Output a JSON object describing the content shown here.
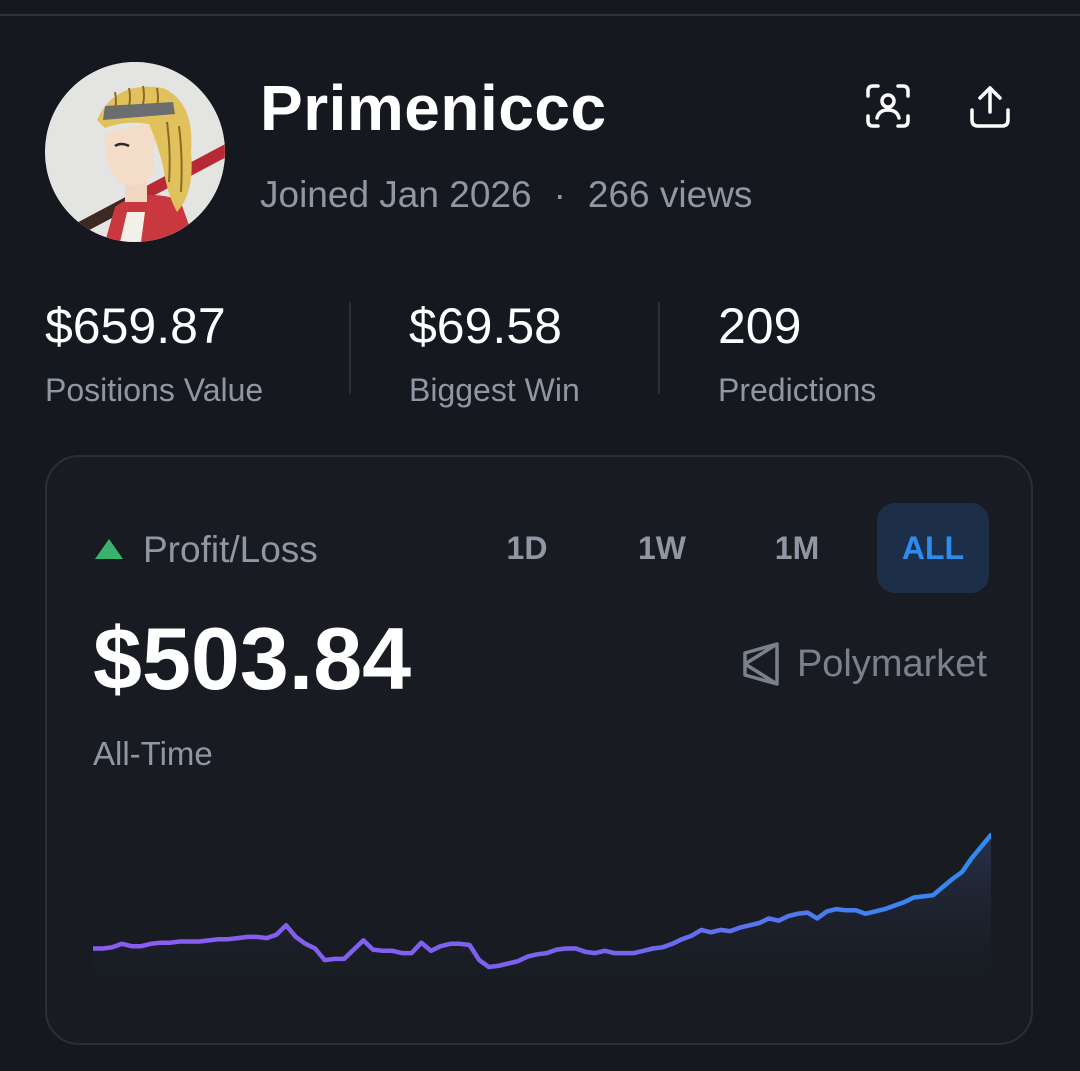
{
  "profile": {
    "username": "Primeniccc",
    "joined": "Joined Jan 2026",
    "separator": "·",
    "views": "266 views"
  },
  "header_icons": {
    "scan": "qr-scan-profile-icon",
    "share": "share-upload-icon"
  },
  "stats": [
    {
      "value": "$659.87",
      "label": "Positions Value"
    },
    {
      "value": "$69.58",
      "label": "Biggest Win"
    },
    {
      "value": "209",
      "label": "Predictions"
    }
  ],
  "pnl_card": {
    "title": "Profit/Loss",
    "trend_color": "#3bb26b",
    "tabs": [
      "1D",
      "1W",
      "1M",
      "ALL"
    ],
    "selected_tab": "ALL",
    "value": "$503.84",
    "period": "All-Time",
    "brand": "Polymarket"
  },
  "chart_data": {
    "type": "area",
    "title": "",
    "xlabel": "",
    "ylabel": "",
    "grid": false,
    "gradient": [
      "#8a5cf0",
      "#2d8cf0"
    ],
    "values": [
      10,
      10,
      11,
      14,
      12,
      12,
      14,
      15,
      15,
      16,
      16,
      16,
      17,
      18,
      18,
      19,
      20,
      20,
      19,
      22,
      30,
      20,
      14,
      10,
      0,
      1,
      1,
      9,
      17,
      9,
      8,
      8,
      6,
      6,
      15,
      8,
      12,
      14,
      14,
      13,
      0,
      -6,
      -5,
      -3,
      -1,
      3,
      5,
      6,
      9,
      10,
      10,
      7,
      6,
      8,
      6,
      6,
      6,
      8,
      10,
      11,
      14,
      18,
      21,
      26,
      24,
      26,
      25,
      28,
      30,
      32,
      36,
      34,
      38,
      40,
      41,
      36,
      42,
      44,
      43,
      43,
      40,
      42,
      44,
      47,
      50,
      54,
      55,
      56,
      63,
      70,
      76,
      88,
      98,
      108
    ]
  }
}
